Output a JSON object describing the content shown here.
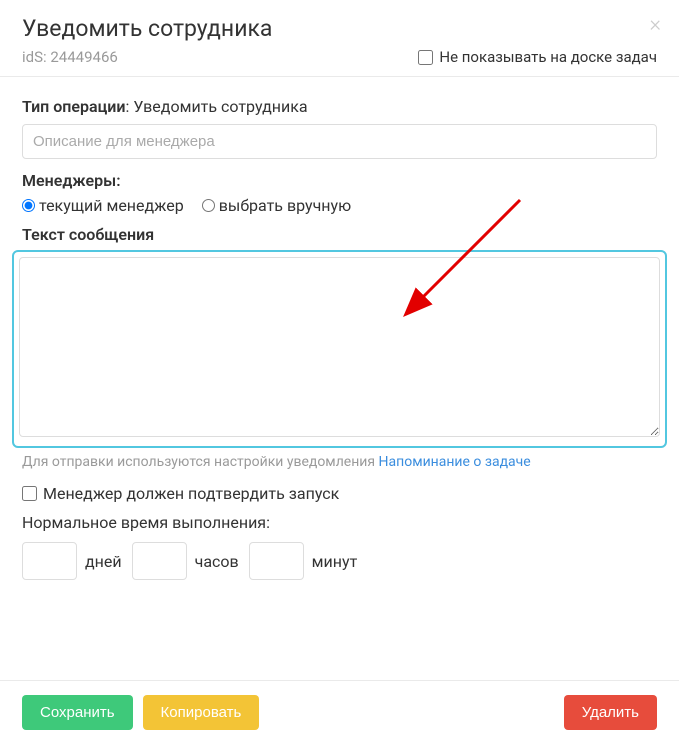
{
  "header": {
    "title": "Уведомить сотрудника",
    "id_label": "idS: 24449466",
    "hide_checkbox_label": "Не показывать на доске задач"
  },
  "operation": {
    "label_bold": "Тип операции",
    "label_value": ": Уведомить сотрудника",
    "desc_placeholder": "Описание для менеджера"
  },
  "managers": {
    "label": "Менеджеры:",
    "option_current": "текущий менеджер",
    "option_manual": "выбрать вручную"
  },
  "message": {
    "label": "Текст сообщения",
    "hint_text": "Для отправки используются настройки уведомления ",
    "hint_link": "Напоминание о задаче"
  },
  "confirm": {
    "label": "Менеджер должен подтвердить запуск"
  },
  "time": {
    "label": "Нормальное время выполнения:",
    "days": "дней",
    "hours": "часов",
    "minutes": "минут"
  },
  "footer": {
    "save": "Сохранить",
    "copy": "Копировать",
    "delete": "Удалить"
  }
}
